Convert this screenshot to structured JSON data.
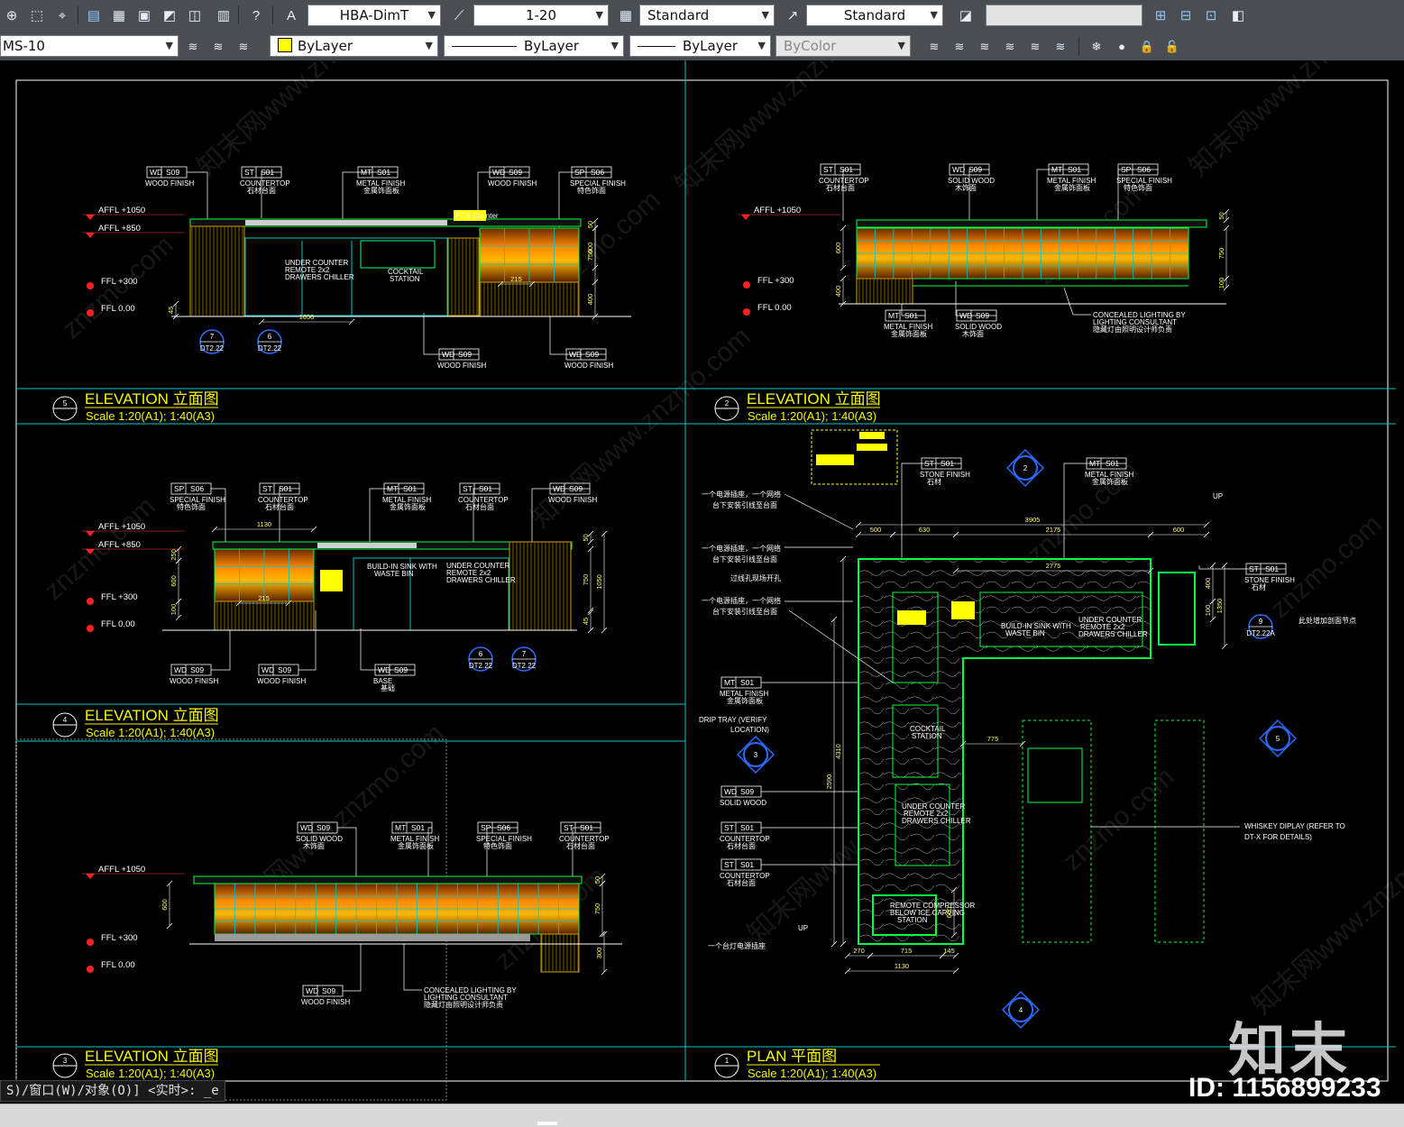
{
  "toolbar1": {
    "dimstyle": "HBA-DimT",
    "scale": "1-20",
    "tablestyle": "Standard",
    "mleaderstyle": "Standard",
    "icons": [
      "zoom-extents-icon",
      "zoom-window-icon",
      "layer-isolate-icon",
      "save-icon",
      "properties-icon",
      "block-icon",
      "match-icon",
      "layer-state-icon",
      "calculator-icon",
      "help-icon",
      "text-style-icon",
      "dim-style-icon",
      "table-style-icon",
      "mleader-style-icon",
      "tool-palette-icon",
      "viewport-icon"
    ]
  },
  "toolbar2": {
    "layer": "MS-10",
    "color": "ByLayer",
    "linetype": "ByLayer",
    "lineweight": "ByLayer",
    "plotstyle": "ByColor"
  },
  "colors": {
    "accent": "#ffff00",
    "panel_border": "#00c8c8",
    "finish_orange": "#e06a00",
    "outline_green": "#00ff40",
    "background": "#000000"
  },
  "views": [
    {
      "id": "v5",
      "num": "5",
      "title": "ELEVATION 立面图",
      "scale": "Scale 1:20(A1); 1:40(A3)"
    },
    {
      "id": "v2",
      "num": "2",
      "title": "ELEVATION 立面图",
      "scale": "Scale 1:20(A1); 1:40(A3)"
    },
    {
      "id": "v4",
      "num": "4",
      "title": "ELEVATION 立面图",
      "scale": "Scale 1:20(A1); 1:40(A3)"
    },
    {
      "id": "v3",
      "num": "3",
      "title": "ELEVATION 立面图",
      "scale": "Scale 1:20(A1); 1:40(A3)"
    },
    {
      "id": "v1",
      "num": "1",
      "title": "PLAN   平面图",
      "scale": "Scale 1:20(A1); 1:40(A3)"
    }
  ],
  "tags": {
    "v5": [
      {
        "c": "WD",
        "n": "S09",
        "l1": "WOOD FINISH",
        "l2": ""
      },
      {
        "c": "ST",
        "n": "S01",
        "l1": "COUNTERTOP",
        "l2": "石材台面"
      },
      {
        "c": "MT",
        "n": "S01",
        "l1": "METAL FINISH",
        "l2": "金属饰面板"
      },
      {
        "c": "WD",
        "n": "S09",
        "l1": "WOOD FINISH",
        "l2": ""
      },
      {
        "c": "SP",
        "n": "S06",
        "l1": "SPECIAL FINISH",
        "l2": "特色饰面"
      },
      {
        "c": "WD",
        "n": "S09",
        "l1": "WOOD FINISH",
        "l2": ""
      },
      {
        "c": "WD",
        "n": "S09",
        "l1": "WOOD FINISH",
        "l2": ""
      }
    ],
    "v2": [
      {
        "c": "ST",
        "n": "S01",
        "l1": "COUNTERTOP",
        "l2": "石材台面"
      },
      {
        "c": "WD",
        "n": "S09",
        "l1": "SOLID WOOD",
        "l2": "木饰面"
      },
      {
        "c": "MT",
        "n": "S01",
        "l1": "METAL FINISH",
        "l2": "金属饰面板"
      },
      {
        "c": "SP",
        "n": "S06",
        "l1": "SPECIAL FINISH",
        "l2": "特色饰面"
      },
      {
        "c": "MT",
        "n": "S01",
        "l1": "METAL FINISH",
        "l2": "金属饰面板"
      },
      {
        "c": "WD",
        "n": "S09",
        "l1": "SOLID WOOD",
        "l2": "木饰面"
      }
    ],
    "v4": [
      {
        "c": "SP",
        "n": "S06",
        "l1": "SPECIAL FINISH",
        "l2": "特色饰面"
      },
      {
        "c": "ST",
        "n": "S01",
        "l1": "COUNTERTOP",
        "l2": "石材台面"
      },
      {
        "c": "MT",
        "n": "S01",
        "l1": "METAL FINISH",
        "l2": "金属饰面板"
      },
      {
        "c": "ST",
        "n": "S01",
        "l1": "COUNTERTOP",
        "l2": "石材台面"
      },
      {
        "c": "WD",
        "n": "S09",
        "l1": "WOOD FINISH",
        "l2": ""
      },
      {
        "c": "WD",
        "n": "S09",
        "l1": "WOOD FINISH",
        "l2": ""
      },
      {
        "c": "WD",
        "n": "S09",
        "l1": "WOOD FINISH",
        "l2": ""
      },
      {
        "c": "WD",
        "n": "S09",
        "l1": "BASE",
        "l2": "基础"
      }
    ],
    "v3": [
      {
        "c": "WD",
        "n": "S09",
        "l1": "SOLID WOOD",
        "l2": "木饰面"
      },
      {
        "c": "MT",
        "n": "S01",
        "l1": "METAL FINISH",
        "l2": "金属饰面板"
      },
      {
        "c": "SP",
        "n": "S06",
        "l1": "SPECIAL FINISH",
        "l2": "特色饰面"
      },
      {
        "c": "ST",
        "n": "S01",
        "l1": "COUNTERTOP",
        "l2": "石材台面"
      },
      {
        "c": "WD",
        "n": "S09",
        "l1": "WOOD FINISH",
        "l2": ""
      }
    ],
    "v1": [
      {
        "c": "ST",
        "n": "S01",
        "l1": "STONE FINISH",
        "l2": "石材"
      },
      {
        "c": "MT",
        "n": "S01",
        "l1": "METAL FINISH",
        "l2": "金属饰面板"
      },
      {
        "c": "ST",
        "n": "S01",
        "l1": "STONE FINISH",
        "l2": "石材"
      },
      {
        "c": "MT",
        "n": "S01",
        "l1": "METAL FINISH",
        "l2": "金属饰面板"
      },
      {
        "c": "WD",
        "n": "S09",
        "l1": "SOLID WOOD",
        "l2": ""
      },
      {
        "c": "ST",
        "n": "S01",
        "l1": "COUNTERTOP",
        "l2": "石材台面"
      },
      {
        "c": "ST",
        "n": "S01",
        "l1": "COUNTERTOP",
        "l2": "石材台面"
      }
    ]
  },
  "levels": {
    "v5": [
      "AFFL +1050",
      "AFFL +850",
      "FFL +300",
      "FFL 0.00"
    ],
    "v2": [
      "AFFL +1050",
      "FFL +300",
      "FFL 0.00"
    ],
    "v4": [
      "AFFL +1050",
      "AFFL +850",
      "FFL +300",
      "FFL 0.00"
    ],
    "v3": [
      "AFFL +1050",
      "FFL +300",
      "FFL 0.00"
    ]
  },
  "notes": {
    "lighting": "CONCEALED LIGHTING BY",
    "lighting2": "LIGHTING CONSULTANT",
    "lighting_cn": "隐藏灯由照明设计师负责",
    "under_counter": "UNDER COUNTER",
    "remote": "REMOTE 2x2",
    "drawers": "DRAWERS CHILLER",
    "cocktail": "COCKTAIL",
    "station": "STATION",
    "sink": "BUILD-IN SINK WITH",
    "waste": "WASTE BIN",
    "pos": "POS Counter",
    "whiskey": "WHISKEY DIPLAY (REFER TO",
    "whiskey2": "DT-X FOR DETAILS)",
    "drip": "DRIP TRAY (VERIFY",
    "drip2": "LOCATION)",
    "socket1": "一个电源插座，一个网络",
    "socket1b": "台下安装引线至台面",
    "hole": "过线孔现场开孔",
    "lamp": "一个台灯电源插座",
    "addnode": "此处增加剖面节点",
    "up": "UP",
    "compressor": "REMOTE COMPRESSOR",
    "below_ice": "BELOW ICE CARVING",
    "station2": "STATION"
  },
  "detail_marks": {
    "v5": [
      {
        "n": "7",
        "ref": "DT2.22"
      },
      {
        "n": "6",
        "ref": "DT2.22"
      }
    ],
    "v4": [
      {
        "n": "6",
        "ref": "DT2.22"
      },
      {
        "n": "7",
        "ref": "DT2.22"
      }
    ],
    "v1": [
      {
        "n": "9",
        "ref": "DT2.22A"
      }
    ]
  },
  "plan_marks": [
    "2",
    "3",
    "4",
    "5"
  ],
  "dims": {
    "v5": [
      "50",
      "750",
      "45",
      "600",
      "400",
      "215",
      "1050"
    ],
    "v2": [
      "50",
      "750",
      "100",
      "600",
      "400"
    ],
    "v4": [
      "1130",
      "215",
      "250",
      "600",
      "100",
      "50",
      "750",
      "1050",
      "45"
    ],
    "v3": [
      "50",
      "750",
      "600",
      "300"
    ],
    "v1": [
      "3905",
      "500",
      "630",
      "2175",
      "600",
      "2775",
      "4310",
      "2590",
      "775",
      "1130",
      "270",
      "715",
      "145",
      "400",
      "100",
      "600",
      "1350"
    ]
  },
  "command_line": "S)/窗口(W)/对象(O)] <实时>: _e",
  "watermark": {
    "logo": "知末",
    "id": "ID: 1156899233",
    "text": "znzmo.com",
    "text_cn": "知末网www.znzmo.com"
  }
}
